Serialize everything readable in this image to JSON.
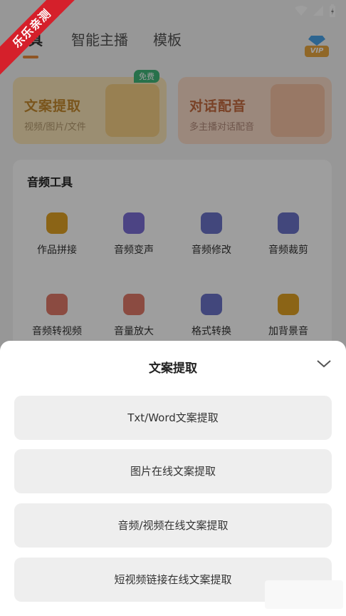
{
  "tabs": [
    {
      "label": "具"
    },
    {
      "label": "智能主播"
    },
    {
      "label": "模板"
    }
  ],
  "vip": {
    "label": "VIP"
  },
  "promo": {
    "left": {
      "title": "文案提取",
      "subtitle": "视频/图片/文件",
      "tag": "免费"
    },
    "right": {
      "title": "对话配音",
      "subtitle": "多主播对话配音"
    }
  },
  "tools": {
    "title": "音频工具",
    "items": [
      {
        "label": "作品拼接",
        "icon": "waveform-icon",
        "color": "#e0a224"
      },
      {
        "label": "音频变声",
        "icon": "magic-wand-icon",
        "color": "#7b6fd6"
      },
      {
        "label": "音频修改",
        "icon": "audio-file-edit-icon",
        "color": "#6b73c8"
      },
      {
        "label": "音频裁剪",
        "icon": "audio-file-cut-icon",
        "color": "#6b73c8"
      },
      {
        "label": "音频转视频",
        "icon": "audio-to-video-icon",
        "color": "#e07a6a"
      },
      {
        "label": "音量放大",
        "icon": "volume-up-icon",
        "color": "#e07a6a"
      },
      {
        "label": "格式转换",
        "icon": "format-convert-icon",
        "color": "#6b73c8"
      },
      {
        "label": "加背景音",
        "icon": "add-music-icon",
        "color": "#e0a224"
      }
    ]
  },
  "watermark": {
    "text": "乐乐亲测"
  },
  "sheet": {
    "title": "文案提取",
    "options": [
      {
        "label": "Txt/Word文案提取"
      },
      {
        "label": "图片在线文案提取"
      },
      {
        "label": "音频/视频在线文案提取"
      },
      {
        "label": "短视频链接在线文案提取"
      }
    ]
  }
}
